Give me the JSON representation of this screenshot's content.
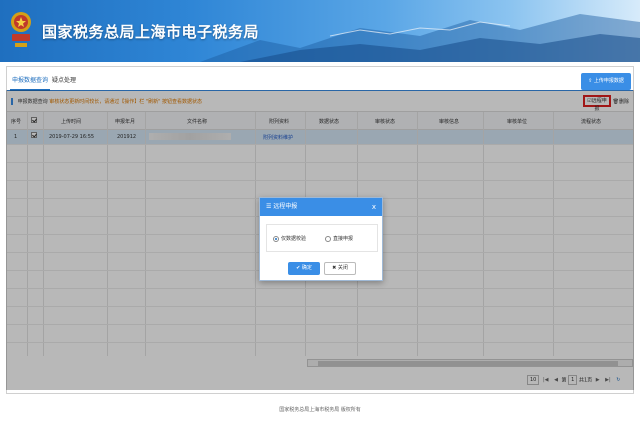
{
  "header": {
    "site_title": "国家税务总局上海市电子税务局"
  },
  "tabs": [
    {
      "label": "申报数据查询",
      "active": true
    },
    {
      "label": "疑点处理",
      "active": false
    }
  ],
  "toolbar": {
    "upload_label": "上传申报数据",
    "remote_label": "远程申报",
    "delete_label": "删除"
  },
  "notice": {
    "label": "申报数据查询",
    "warning": "审核状态更新时间较长，请通过【操作】栏 \"刷新\" 按钮查看数据状态"
  },
  "table": {
    "headers": [
      "序号",
      "",
      "上传时间",
      "申报年月",
      "文件名称",
      "附列资料",
      "数据状态",
      "审核状态",
      "审核信息",
      "审核单位",
      "流程状态"
    ],
    "rows": [
      {
        "index": "1",
        "checked": true,
        "upload_time": "2019-07-29 16:55",
        "period": "201912",
        "filename": "",
        "attachment": "附列资料维护"
      }
    ]
  },
  "pager": {
    "page_size": "10",
    "page_label": "第",
    "page": "1",
    "total": "共1页"
  },
  "footer": {
    "text": "国家税务总局上海市税务局 版权所有"
  },
  "dialog": {
    "title": "远程申报",
    "options": [
      {
        "label": "仅数据校验",
        "selected": true
      },
      {
        "label": "直接申报",
        "selected": false
      }
    ],
    "ok_label": "确定",
    "cancel_label": "关闭"
  },
  "colors": {
    "primary": "#3a8ee6",
    "header_dark": "#1f6fbf",
    "warning": "#e07b00",
    "highlight": "#e02020",
    "row_selected": "#d6e8f7"
  }
}
